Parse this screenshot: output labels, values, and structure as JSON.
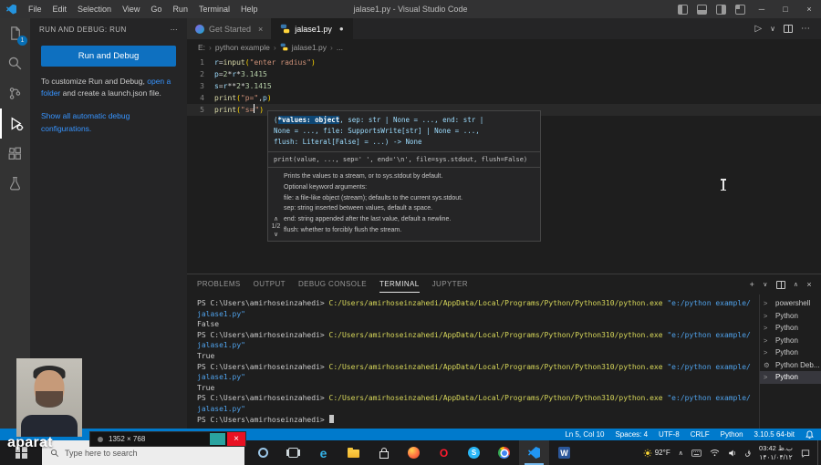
{
  "titlebar": {
    "menus": [
      "File",
      "Edit",
      "Selection",
      "View",
      "Go",
      "Run",
      "Terminal",
      "Help"
    ],
    "title": "jalase1.py - Visual Studio Code",
    "window_controls": {
      "minimize": "─",
      "maximize": "□",
      "close": "×"
    }
  },
  "activity_bar": {
    "explorer_badge": "1"
  },
  "sidebar": {
    "header": "RUN AND DEBUG: RUN",
    "actions_icon": "⋯",
    "run_button": "Run and Debug",
    "hint_pre": "To customize Run and Debug, ",
    "hint_link": "open a folder",
    "hint_post": " and create a launch.json file.",
    "show_configs_link": "Show all automatic debug configurations."
  },
  "editor": {
    "tabs": {
      "tab1": "Get Started",
      "tab2": "jalase1.py",
      "close_icon": "×",
      "modified_dot": "●"
    },
    "actions": {
      "run": "▷",
      "dropdown": "∨",
      "more": "⋯"
    },
    "breadcrumb": [
      "E:",
      "python example",
      "jalase1.py",
      "..."
    ],
    "code_lines": [
      {
        "tokens": [
          {
            "t": "r",
            "c": "v"
          },
          {
            "t": "=",
            "c": "o"
          },
          {
            "t": "input",
            "c": "f"
          },
          {
            "t": "(",
            "c": "p"
          },
          {
            "t": "\"enter radius\"",
            "c": "s"
          },
          {
            "t": ")",
            "c": "p"
          }
        ]
      },
      {
        "tokens": [
          {
            "t": "p",
            "c": "v"
          },
          {
            "t": "=",
            "c": "o"
          },
          {
            "t": "2",
            "c": "n"
          },
          {
            "t": "*",
            "c": "o"
          },
          {
            "t": "r",
            "c": "v"
          },
          {
            "t": "*",
            "c": "o"
          },
          {
            "t": "3.1415",
            "c": "n"
          }
        ]
      },
      {
        "tokens": [
          {
            "t": "s",
            "c": "v"
          },
          {
            "t": "=",
            "c": "o"
          },
          {
            "t": "r",
            "c": "v"
          },
          {
            "t": "**",
            "c": "o"
          },
          {
            "t": "2",
            "c": "n"
          },
          {
            "t": "*",
            "c": "o"
          },
          {
            "t": "3.1415",
            "c": "n"
          }
        ]
      },
      {
        "tokens": [
          {
            "t": "print",
            "c": "f"
          },
          {
            "t": "(",
            "c": "p"
          },
          {
            "t": "\"p=\"",
            "c": "s"
          },
          {
            "t": ",",
            "c": "o"
          },
          {
            "t": "p",
            "c": "v"
          },
          {
            "t": ")",
            "c": "p"
          }
        ]
      },
      {
        "current": true,
        "tokens": [
          {
            "t": "print",
            "c": "f"
          },
          {
            "t": "(",
            "c": "p"
          },
          {
            "t": "\"s=",
            "c": "s"
          },
          {
            "t": "",
            "c": "cursor"
          },
          {
            "t": "\"",
            "c": "s"
          },
          {
            "t": ")",
            "c": "p"
          }
        ]
      }
    ]
  },
  "tooltip": {
    "signature_lines": [
      [
        {
          "t": "(",
          "c": "sg"
        },
        {
          "t": "*values: object",
          "c": "hl"
        },
        {
          "t": ", sep: str | None = ..., end: str |",
          "c": "sg"
        }
      ],
      [
        {
          "t": "None = ..., file: SupportsWrite[str] | None = ...,",
          "c": "sg"
        }
      ],
      [
        {
          "t": "flush: Literal[False] = ...) -> None",
          "c": "sg"
        }
      ]
    ],
    "usage": "print(value, ..., sep=' ', end='\\n', file=sys.stdout, flush=False)",
    "doc_lines": [
      "Prints the values to a stream, or to sys.stdout by default.",
      "Optional keyword arguments:",
      "file: a file-like object (stream); defaults to the current sys.stdout.",
      "sep: string inserted between values, default a space.",
      "end: string appended after the last value, default a newline.",
      "flush: whether to forcibly flush the stream."
    ],
    "pager": {
      "up": "∧",
      "label": "1/2",
      "down": "∨"
    }
  },
  "panel": {
    "tabs": [
      {
        "label": "PROBLEMS"
      },
      {
        "label": "OUTPUT"
      },
      {
        "label": "DEBUG CONSOLE"
      },
      {
        "label": "TERMINAL",
        "active": true
      },
      {
        "label": "JUPYTER"
      }
    ],
    "actions": {
      "new": "+",
      "dropdown": "∨",
      "maximize": "∧",
      "close": "×"
    }
  },
  "terminal": {
    "lines": [
      [
        {
          "t": "PS C:\\Users\\amirhoseinzahedi> ",
          "c": "pr"
        },
        {
          "t": "C:/Users/amirhoseinzahedi/AppData/Local/Programs/Python/Python310/python.exe",
          "c": "cm"
        },
        {
          "t": " \"e:/python example/",
          "c": "st"
        }
      ],
      [
        {
          "t": "jalase1.py\"",
          "c": "st"
        }
      ],
      [
        {
          "t": "False",
          "c": "out"
        }
      ],
      [
        {
          "t": "PS C:\\Users\\amirhoseinzahedi> ",
          "c": "pr"
        },
        {
          "t": "C:/Users/amirhoseinzahedi/AppData/Local/Programs/Python/Python310/python.exe",
          "c": "cm"
        },
        {
          "t": " \"e:/python example/",
          "c": "st"
        }
      ],
      [
        {
          "t": "jalase1.py\"",
          "c": "st"
        }
      ],
      [
        {
          "t": "True",
          "c": "out"
        }
      ],
      [
        {
          "t": "PS C:\\Users\\amirhoseinzahedi> ",
          "c": "pr"
        },
        {
          "t": "C:/Users/amirhoseinzahedi/AppData/Local/Programs/Python/Python310/python.exe",
          "c": "cm"
        },
        {
          "t": " \"e:/python example/",
          "c": "st"
        }
      ],
      [
        {
          "t": "jalase1.py\"",
          "c": "st"
        }
      ],
      [
        {
          "t": "True",
          "c": "out"
        }
      ],
      [
        {
          "t": "PS C:\\Users\\amirhoseinzahedi> ",
          "c": "pr"
        },
        {
          "t": "C:/Users/amirhoseinzahedi/AppData/Local/Programs/Python/Python310/python.exe",
          "c": "cm"
        },
        {
          "t": " \"e:/python example/",
          "c": "st"
        }
      ],
      [
        {
          "t": "jalase1.py\"",
          "c": "st"
        }
      ],
      [
        {
          "t": "PS C:\\Users\\amirhoseinzahedi> ",
          "c": "pr"
        },
        {
          "t": "",
          "c": "cursor"
        }
      ]
    ],
    "sessions": [
      {
        "icon": ">",
        "label": "powershell"
      },
      {
        "icon": ">",
        "label": "Python"
      },
      {
        "icon": ">",
        "label": "Python"
      },
      {
        "icon": ">",
        "label": "Python"
      },
      {
        "icon": ">",
        "label": "Python"
      },
      {
        "icon": "⚙",
        "label": "Python Deb..."
      },
      {
        "icon": ">",
        "label": "Python",
        "selected": true
      }
    ]
  },
  "statusbar": {
    "items": [
      {
        "name": "cursor-position",
        "label": "Ln 5, Col 10"
      },
      {
        "name": "indentation",
        "label": "Spaces: 4"
      },
      {
        "name": "encoding",
        "label": "UTF-8"
      },
      {
        "name": "eol",
        "label": "CRLF"
      },
      {
        "name": "language",
        "label": "Python"
      },
      {
        "name": "interpreter",
        "label": "3.10.5 64-bit"
      }
    ]
  },
  "taskbar": {
    "search_placeholder": "Type here to search",
    "icons": [
      {
        "name": "cortana",
        "cls": "tb-ring"
      },
      {
        "name": "task-view",
        "cls": "tb-taskview"
      },
      {
        "name": "edge",
        "cls": "tb-edge",
        "glyph": "e"
      },
      {
        "name": "file-explorer",
        "cls": "tb-folder"
      },
      {
        "name": "store",
        "cls": "tb-bag"
      },
      {
        "name": "firefox",
        "cls": "tb-firefox"
      },
      {
        "name": "opera",
        "cls": "tb-opera",
        "glyph": "O"
      },
      {
        "name": "skype",
        "cls": "tb-bluecircle",
        "glyph": "S"
      },
      {
        "name": "chrome",
        "cls": "tb-chrome"
      },
      {
        "name": "vscode",
        "cls": "tb-vscode",
        "active": true
      },
      {
        "name": "word",
        "cls": "tb-word",
        "glyph": "W"
      }
    ],
    "tray": {
      "weather": "92°F",
      "chevron": "∧",
      "language": "ق",
      "time": "03:42 ب.ظ",
      "date": "۱۴۰۱/۰۴/۱۲"
    }
  },
  "overlays": {
    "watermark": "aparat",
    "recorder_text": "1352 × 768",
    "recorder_close": "×"
  }
}
